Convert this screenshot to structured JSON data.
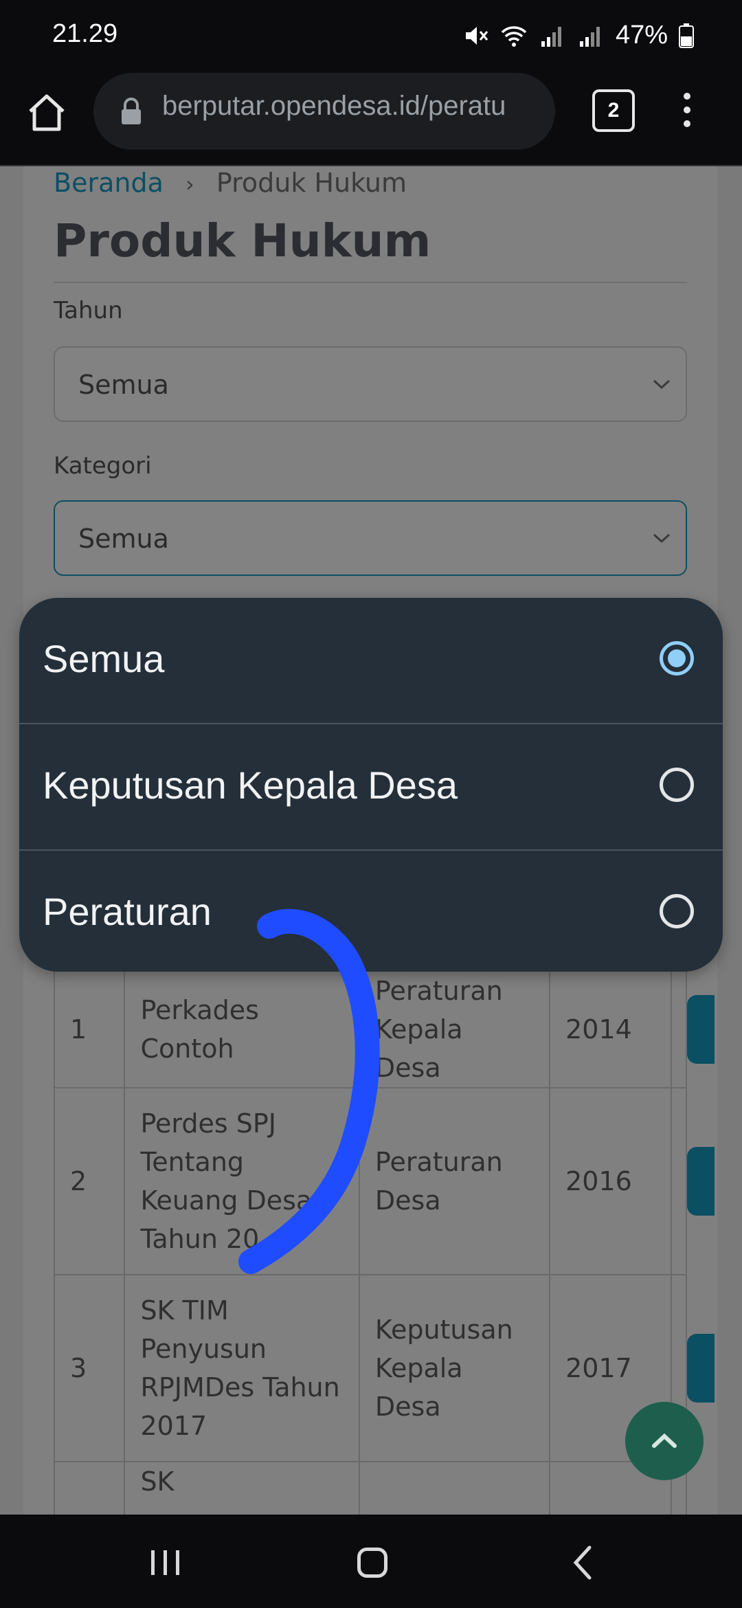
{
  "status_bar": {
    "time": "21.29",
    "battery": "47%",
    "icons": [
      "mute-icon",
      "wifi-icon",
      "signal-icon",
      "signal-icon",
      "battery-icon"
    ]
  },
  "browser": {
    "url": "berputar.opendesa.id/peratu",
    "tab_count": "2"
  },
  "page": {
    "breadcrumb": {
      "home": "Beranda",
      "current": "Produk Hukum"
    },
    "title": "Produk Hukum",
    "filters": {
      "tahun_label": "Tahun",
      "tahun_value": "Semua",
      "kategori_label": "Kategori",
      "kategori_value": "Semua"
    },
    "table_rows": [
      {
        "no": "1",
        "judul": "Perkades Contoh",
        "kategori": "Peraturan Kepala Desa",
        "tahun": "2014"
      },
      {
        "no": "2",
        "judul": "Perdes SPJ Tentang Keuang Desa Tahun 20",
        "kategori": "Peraturan Desa",
        "tahun": "2016"
      },
      {
        "no": "3",
        "judul": "SK TIM Penyusun RPJMDes Tahun 2017",
        "kategori": "Keputusan Kepala Desa",
        "tahun": "2017"
      },
      {
        "no": "",
        "judul": "SK",
        "kategori": "",
        "tahun": ""
      }
    ]
  },
  "dropdown": {
    "options": [
      {
        "label": "Semua",
        "selected": true
      },
      {
        "label": "Keputusan Kepala Desa",
        "selected": false
      },
      {
        "label": "Peraturan",
        "selected": false
      }
    ]
  },
  "colors": {
    "accent_teal": "#0b4f63",
    "sheet_bg": "#242f39",
    "radio_selected": "#8fcff8",
    "scribble": "#1f4cff",
    "fab": "#1e5e4c"
  }
}
